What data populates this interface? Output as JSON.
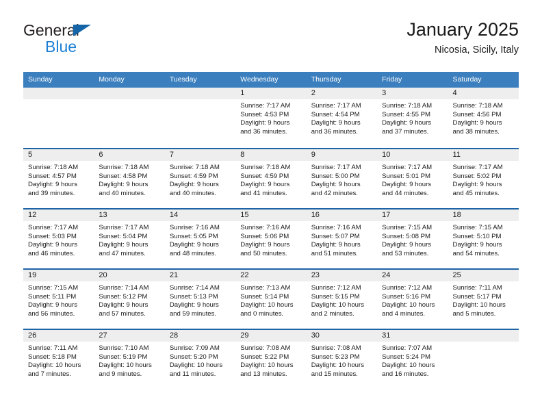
{
  "brand": {
    "line1": "General",
    "line2": "Blue",
    "flag_icon": "triangle-flag-icon",
    "color_dark": "#231f20",
    "color_blue": "#1b7fd4"
  },
  "header": {
    "title": "January 2025",
    "subtitle": "Nicosia, Sicily, Italy"
  },
  "colors": {
    "header_row": "#3c7fbe",
    "row_divider": "#1e63a5",
    "day_band": "#eeeeee"
  },
  "weekdays": [
    "Sunday",
    "Monday",
    "Tuesday",
    "Wednesday",
    "Thursday",
    "Friday",
    "Saturday"
  ],
  "weeks": [
    [
      {
        "day": "",
        "sunrise": "",
        "sunset": "",
        "daylight1": "",
        "daylight2": ""
      },
      {
        "day": "",
        "sunrise": "",
        "sunset": "",
        "daylight1": "",
        "daylight2": ""
      },
      {
        "day": "",
        "sunrise": "",
        "sunset": "",
        "daylight1": "",
        "daylight2": ""
      },
      {
        "day": "1",
        "sunrise": "Sunrise: 7:17 AM",
        "sunset": "Sunset: 4:53 PM",
        "daylight1": "Daylight: 9 hours",
        "daylight2": "and 36 minutes."
      },
      {
        "day": "2",
        "sunrise": "Sunrise: 7:17 AM",
        "sunset": "Sunset: 4:54 PM",
        "daylight1": "Daylight: 9 hours",
        "daylight2": "and 36 minutes."
      },
      {
        "day": "3",
        "sunrise": "Sunrise: 7:18 AM",
        "sunset": "Sunset: 4:55 PM",
        "daylight1": "Daylight: 9 hours",
        "daylight2": "and 37 minutes."
      },
      {
        "day": "4",
        "sunrise": "Sunrise: 7:18 AM",
        "sunset": "Sunset: 4:56 PM",
        "daylight1": "Daylight: 9 hours",
        "daylight2": "and 38 minutes."
      }
    ],
    [
      {
        "day": "5",
        "sunrise": "Sunrise: 7:18 AM",
        "sunset": "Sunset: 4:57 PM",
        "daylight1": "Daylight: 9 hours",
        "daylight2": "and 39 minutes."
      },
      {
        "day": "6",
        "sunrise": "Sunrise: 7:18 AM",
        "sunset": "Sunset: 4:58 PM",
        "daylight1": "Daylight: 9 hours",
        "daylight2": "and 40 minutes."
      },
      {
        "day": "7",
        "sunrise": "Sunrise: 7:18 AM",
        "sunset": "Sunset: 4:59 PM",
        "daylight1": "Daylight: 9 hours",
        "daylight2": "and 40 minutes."
      },
      {
        "day": "8",
        "sunrise": "Sunrise: 7:18 AM",
        "sunset": "Sunset: 4:59 PM",
        "daylight1": "Daylight: 9 hours",
        "daylight2": "and 41 minutes."
      },
      {
        "day": "9",
        "sunrise": "Sunrise: 7:17 AM",
        "sunset": "Sunset: 5:00 PM",
        "daylight1": "Daylight: 9 hours",
        "daylight2": "and 42 minutes."
      },
      {
        "day": "10",
        "sunrise": "Sunrise: 7:17 AM",
        "sunset": "Sunset: 5:01 PM",
        "daylight1": "Daylight: 9 hours",
        "daylight2": "and 44 minutes."
      },
      {
        "day": "11",
        "sunrise": "Sunrise: 7:17 AM",
        "sunset": "Sunset: 5:02 PM",
        "daylight1": "Daylight: 9 hours",
        "daylight2": "and 45 minutes."
      }
    ],
    [
      {
        "day": "12",
        "sunrise": "Sunrise: 7:17 AM",
        "sunset": "Sunset: 5:03 PM",
        "daylight1": "Daylight: 9 hours",
        "daylight2": "and 46 minutes."
      },
      {
        "day": "13",
        "sunrise": "Sunrise: 7:17 AM",
        "sunset": "Sunset: 5:04 PM",
        "daylight1": "Daylight: 9 hours",
        "daylight2": "and 47 minutes."
      },
      {
        "day": "14",
        "sunrise": "Sunrise: 7:16 AM",
        "sunset": "Sunset: 5:05 PM",
        "daylight1": "Daylight: 9 hours",
        "daylight2": "and 48 minutes."
      },
      {
        "day": "15",
        "sunrise": "Sunrise: 7:16 AM",
        "sunset": "Sunset: 5:06 PM",
        "daylight1": "Daylight: 9 hours",
        "daylight2": "and 50 minutes."
      },
      {
        "day": "16",
        "sunrise": "Sunrise: 7:16 AM",
        "sunset": "Sunset: 5:07 PM",
        "daylight1": "Daylight: 9 hours",
        "daylight2": "and 51 minutes."
      },
      {
        "day": "17",
        "sunrise": "Sunrise: 7:15 AM",
        "sunset": "Sunset: 5:08 PM",
        "daylight1": "Daylight: 9 hours",
        "daylight2": "and 53 minutes."
      },
      {
        "day": "18",
        "sunrise": "Sunrise: 7:15 AM",
        "sunset": "Sunset: 5:10 PM",
        "daylight1": "Daylight: 9 hours",
        "daylight2": "and 54 minutes."
      }
    ],
    [
      {
        "day": "19",
        "sunrise": "Sunrise: 7:15 AM",
        "sunset": "Sunset: 5:11 PM",
        "daylight1": "Daylight: 9 hours",
        "daylight2": "and 56 minutes."
      },
      {
        "day": "20",
        "sunrise": "Sunrise: 7:14 AM",
        "sunset": "Sunset: 5:12 PM",
        "daylight1": "Daylight: 9 hours",
        "daylight2": "and 57 minutes."
      },
      {
        "day": "21",
        "sunrise": "Sunrise: 7:14 AM",
        "sunset": "Sunset: 5:13 PM",
        "daylight1": "Daylight: 9 hours",
        "daylight2": "and 59 minutes."
      },
      {
        "day": "22",
        "sunrise": "Sunrise: 7:13 AM",
        "sunset": "Sunset: 5:14 PM",
        "daylight1": "Daylight: 10 hours",
        "daylight2": "and 0 minutes."
      },
      {
        "day": "23",
        "sunrise": "Sunrise: 7:12 AM",
        "sunset": "Sunset: 5:15 PM",
        "daylight1": "Daylight: 10 hours",
        "daylight2": "and 2 minutes."
      },
      {
        "day": "24",
        "sunrise": "Sunrise: 7:12 AM",
        "sunset": "Sunset: 5:16 PM",
        "daylight1": "Daylight: 10 hours",
        "daylight2": "and 4 minutes."
      },
      {
        "day": "25",
        "sunrise": "Sunrise: 7:11 AM",
        "sunset": "Sunset: 5:17 PM",
        "daylight1": "Daylight: 10 hours",
        "daylight2": "and 5 minutes."
      }
    ],
    [
      {
        "day": "26",
        "sunrise": "Sunrise: 7:11 AM",
        "sunset": "Sunset: 5:18 PM",
        "daylight1": "Daylight: 10 hours",
        "daylight2": "and 7 minutes."
      },
      {
        "day": "27",
        "sunrise": "Sunrise: 7:10 AM",
        "sunset": "Sunset: 5:19 PM",
        "daylight1": "Daylight: 10 hours",
        "daylight2": "and 9 minutes."
      },
      {
        "day": "28",
        "sunrise": "Sunrise: 7:09 AM",
        "sunset": "Sunset: 5:20 PM",
        "daylight1": "Daylight: 10 hours",
        "daylight2": "and 11 minutes."
      },
      {
        "day": "29",
        "sunrise": "Sunrise: 7:08 AM",
        "sunset": "Sunset: 5:22 PM",
        "daylight1": "Daylight: 10 hours",
        "daylight2": "and 13 minutes."
      },
      {
        "day": "30",
        "sunrise": "Sunrise: 7:08 AM",
        "sunset": "Sunset: 5:23 PM",
        "daylight1": "Daylight: 10 hours",
        "daylight2": "and 15 minutes."
      },
      {
        "day": "31",
        "sunrise": "Sunrise: 7:07 AM",
        "sunset": "Sunset: 5:24 PM",
        "daylight1": "Daylight: 10 hours",
        "daylight2": "and 16 minutes."
      },
      {
        "day": "",
        "sunrise": "",
        "sunset": "",
        "daylight1": "",
        "daylight2": ""
      }
    ]
  ]
}
